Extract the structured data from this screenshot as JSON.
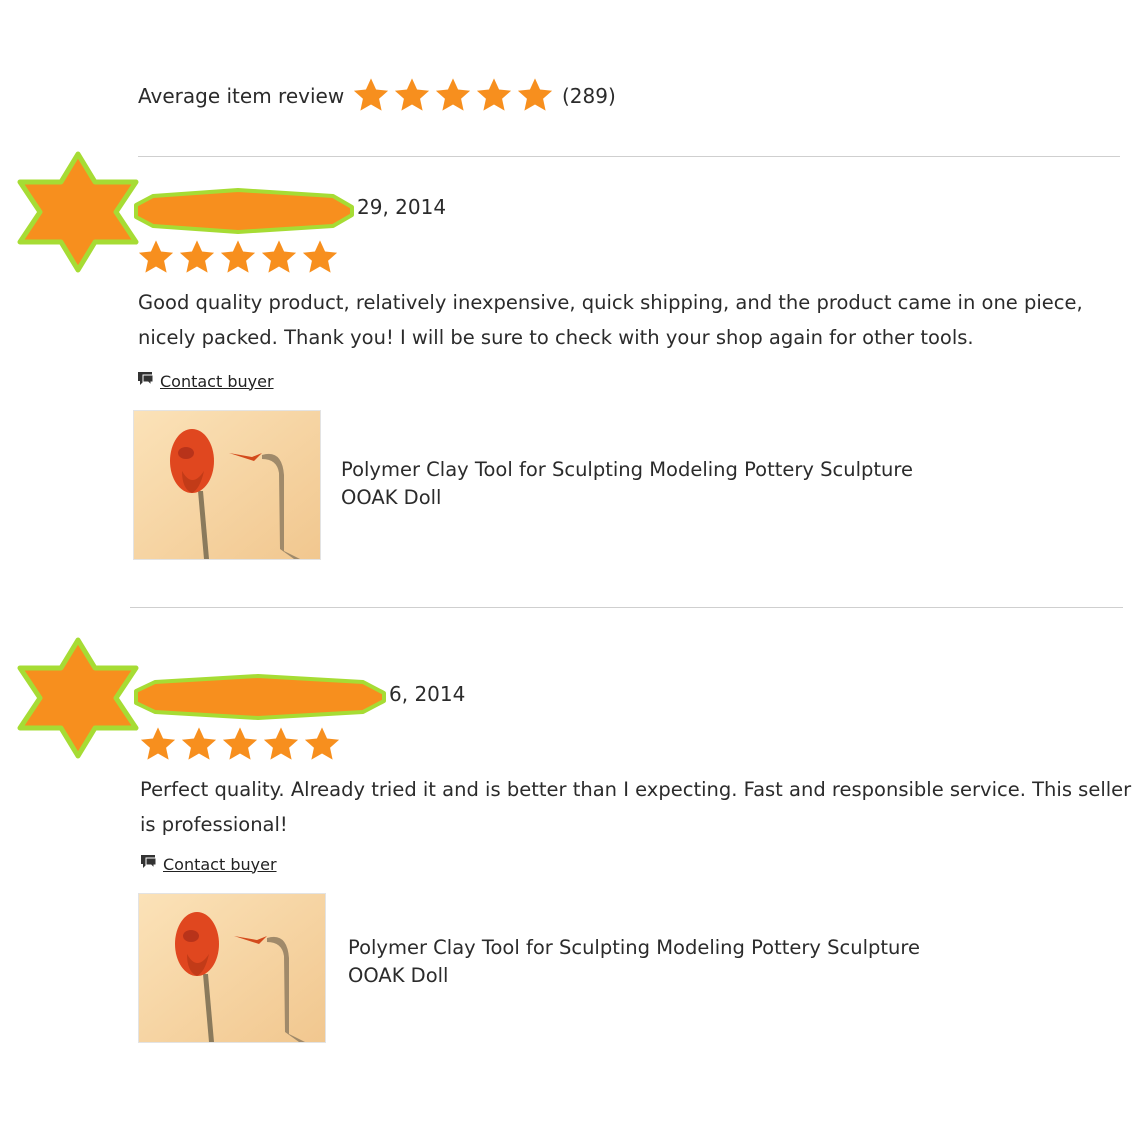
{
  "summary": {
    "label": "Average item review",
    "rating": 5,
    "rating_max": 5,
    "count": "(289)",
    "star_icon": "star-icon",
    "star_color": "#f78f1e"
  },
  "colors": {
    "accent_orange": "#f78f1e",
    "highlight_green": "#a6dc34",
    "text": "#2b2b2b",
    "divider": "#cfcfcf"
  },
  "reviews": [
    {
      "avatar_icon": "star-burst-icon",
      "date": "29, 2014",
      "rating": 5,
      "rating_max": 5,
      "text": "Good quality product, relatively inexpensive, quick shipping, and the product came in one piece, nicely packed. Thank you! I will be sure to check with your shop again for other tools.",
      "contact_label": "Contact buyer",
      "contact_icon": "message-icon",
      "listing_title": "Polymer Clay Tool for Sculpting Modeling Pottery Sculpture OOAK Doll"
    },
    {
      "avatar_icon": "star-burst-icon",
      "date": "6, 2014",
      "rating": 5,
      "rating_max": 5,
      "text": "Perfect quality. Already tried it and is better than I expecting. Fast and responsible service. This seller is professional!",
      "contact_label": "Contact buyer",
      "contact_icon": "message-icon",
      "listing_title": "Polymer Clay Tool for Sculpting Modeling Pottery Sculpture OOAK Doll"
    }
  ]
}
